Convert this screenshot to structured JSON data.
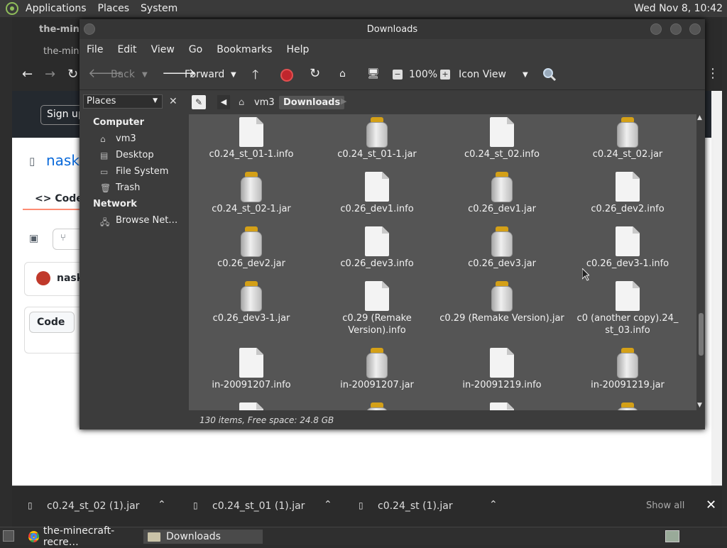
{
  "panel": {
    "menus": [
      "Applications",
      "Places",
      "System"
    ],
    "clock": "Wed Nov 8, 10:42"
  },
  "browser": {
    "tab1": "the-mine",
    "tab2": "the-mine",
    "signup": "Sign up",
    "repo": "nask",
    "code_tab": "Code",
    "user": "nask",
    "code_button": "Code"
  },
  "downloads_bar": {
    "items": [
      "c0.24_st_02 (1).jar",
      "c0.24_st_01 (1).jar",
      "c0.24_st (1).jar"
    ],
    "show_all": "Show all"
  },
  "window": {
    "title": "Downloads"
  },
  "menu": [
    "File",
    "Edit",
    "View",
    "Go",
    "Bookmarks",
    "Help"
  ],
  "toolbar": {
    "back": "Back",
    "forward": "Forward",
    "zoom": "100%",
    "view": "Icon View"
  },
  "sidebar": {
    "header": "Places",
    "computer": "Computer",
    "network": "Network",
    "items": [
      "vm3",
      "Desktop",
      "File System",
      "Trash"
    ],
    "network_items": [
      "Browse Net…"
    ]
  },
  "path": {
    "crumbs": [
      "vm3",
      "Downloads"
    ]
  },
  "files": [
    {
      "name": "c0.24_st_01-1.info",
      "type": "doc"
    },
    {
      "name": "c0.24_st_01-1.jar",
      "type": "jar"
    },
    {
      "name": "c0.24_st_02.info",
      "type": "doc"
    },
    {
      "name": "c0.24_st_02.jar",
      "type": "jar"
    },
    {
      "name": "c0.24_st_02-1.jar",
      "type": "jar"
    },
    {
      "name": "c0.26_dev1.info",
      "type": "doc"
    },
    {
      "name": "c0.26_dev1.jar",
      "type": "jar"
    },
    {
      "name": "c0.26_dev2.info",
      "type": "doc"
    },
    {
      "name": "c0.26_dev2.jar",
      "type": "jar"
    },
    {
      "name": "c0.26_dev3.info",
      "type": "doc"
    },
    {
      "name": "c0.26_dev3.jar",
      "type": "jar"
    },
    {
      "name": "c0.26_dev3-1.info",
      "type": "doc"
    },
    {
      "name": "c0.26_dev3-1.jar",
      "type": "jar"
    },
    {
      "name": "c0.29 (Remake Version).info",
      "type": "doc"
    },
    {
      "name": "c0.29 (Remake Version).jar",
      "type": "jar"
    },
    {
      "name": "c0 (another copy).24_ st_03.info",
      "type": "doc"
    },
    {
      "name": "in-20091207.info",
      "type": "doc"
    },
    {
      "name": "in-20091207.jar",
      "type": "jar"
    },
    {
      "name": "in-20091219.info",
      "type": "doc"
    },
    {
      "name": "in-20091219.jar",
      "type": "jar"
    }
  ],
  "status": "130 items, Free space: 24.8 GB",
  "taskbar": {
    "items": [
      "the-minecraft-recre…",
      "Downloads"
    ]
  }
}
